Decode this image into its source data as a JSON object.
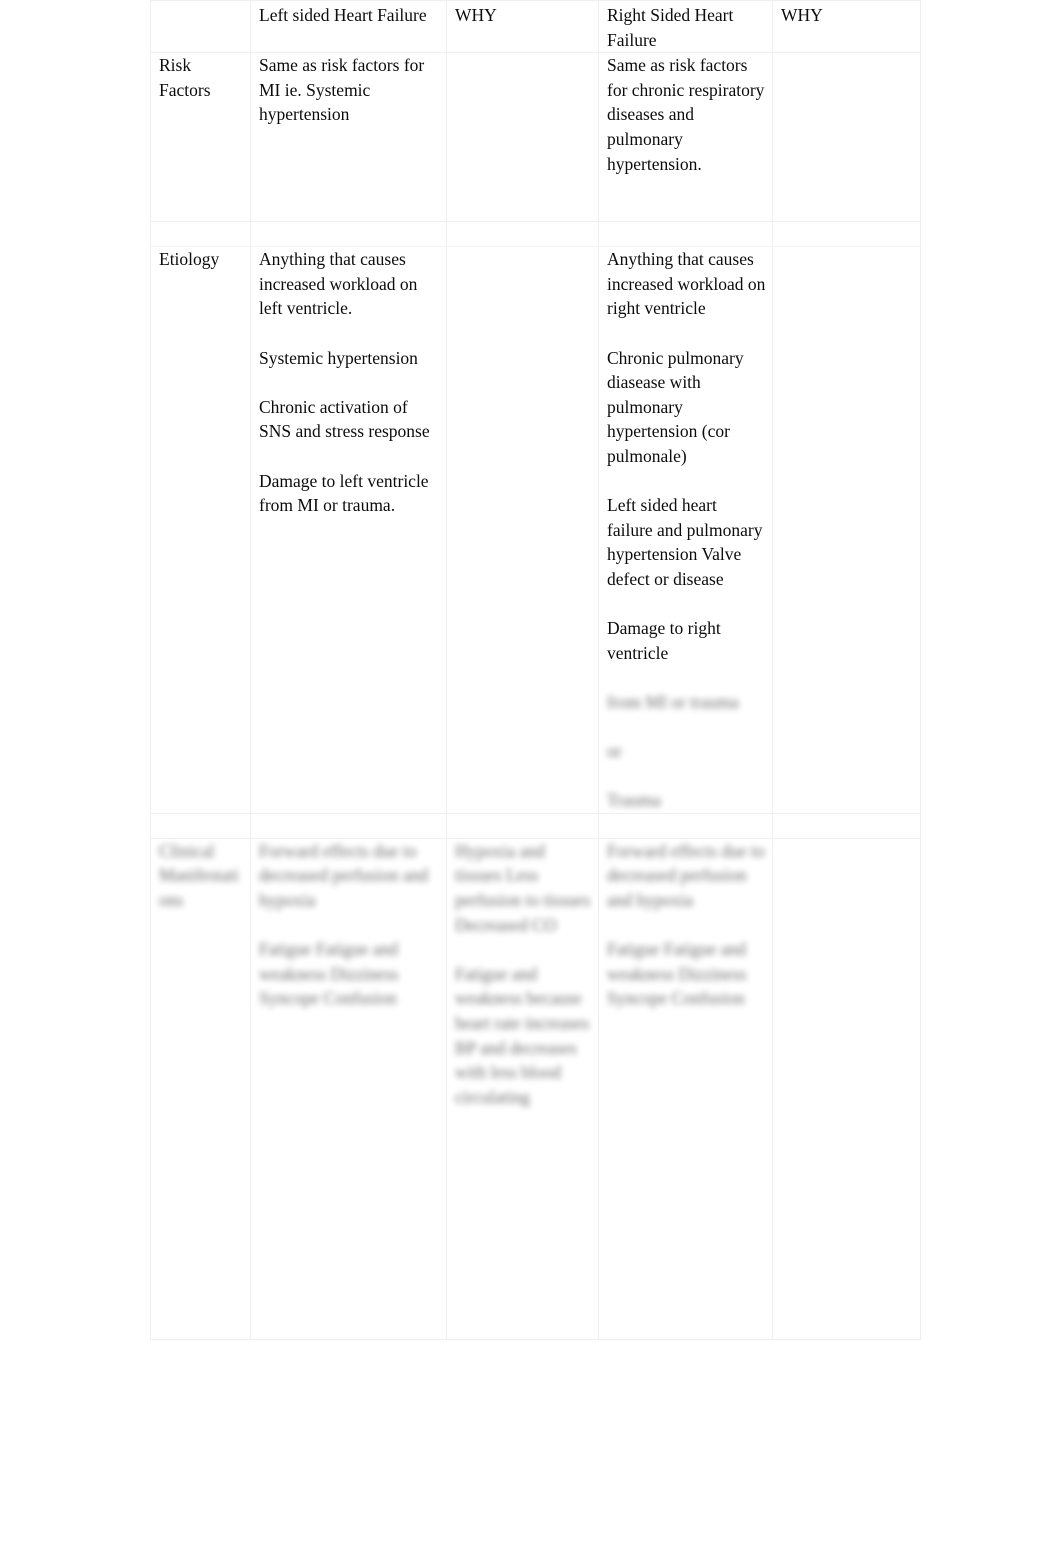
{
  "document": {
    "type": "comparison-table",
    "subject": "Left sided vs Right sided Heart Failure",
    "background_color": "#ffffff",
    "text_color": "#0c0c0c",
    "border_color": "#efefef"
  },
  "table": {
    "columns": [
      {
        "key": "category",
        "header": ""
      },
      {
        "key": "left_hf",
        "header": "Left sided Heart Failure"
      },
      {
        "key": "why_left",
        "header": "WHY"
      },
      {
        "key": "right_hf",
        "header": "Right Sided Heart Failure"
      },
      {
        "key": "why_right",
        "header": "WHY"
      }
    ],
    "rows": [
      {
        "name": "risk-factors",
        "category": "Risk Factors",
        "left_hf": [
          "Same as risk factors for MI ie. Systemic hypertension"
        ],
        "why_left": [],
        "right_hf": [
          "Same as risk factors for chronic respiratory diseases and pulmonary hypertension."
        ],
        "why_right": [],
        "obscured": false
      },
      {
        "name": "etiology",
        "category": "Etiology",
        "left_hf": [
          "Anything that causes increased workload on left ventricle.",
          "Systemic hypertension",
          "Chronic activation of SNS and stress response",
          "Damage to left ventricle from MI or trauma."
        ],
        "why_left": [],
        "right_hf": [
          "Anything that causes increased workload on right ventricle",
          "Chronic pulmonary diasease with pulmonary hypertension (cor pulmonale)",
          "Left sided heart failure and pulmonary hypertension\nValve defect or disease",
          "Damage to right ventricle"
        ],
        "right_hf_obscured_tail": [
          "from MI or trauma",
          "or",
          "Trauma"
        ],
        "why_right": [],
        "obscured": false
      },
      {
        "name": "clinical-manifestations",
        "category": "Clinical Manifestations",
        "obscured": true,
        "left_hf": [
          "Forward effects due to decreased perfusion and hypoxia",
          "Fatigue Fatigue and weakness Dizziness Syncope Confusion"
        ],
        "why_left": [
          "Hypoxia and tissues Less perfusion to tissues Decreased CO",
          "Fatigue and weakness because heart rate increases BP and decreases with less blood circulating"
        ],
        "right_hf": [
          "Forward effects due to decreased perfusion and hypoxia",
          "Fatigue Fatigue and weakness Dizziness Syncope Confusion"
        ],
        "why_right": []
      }
    ]
  }
}
